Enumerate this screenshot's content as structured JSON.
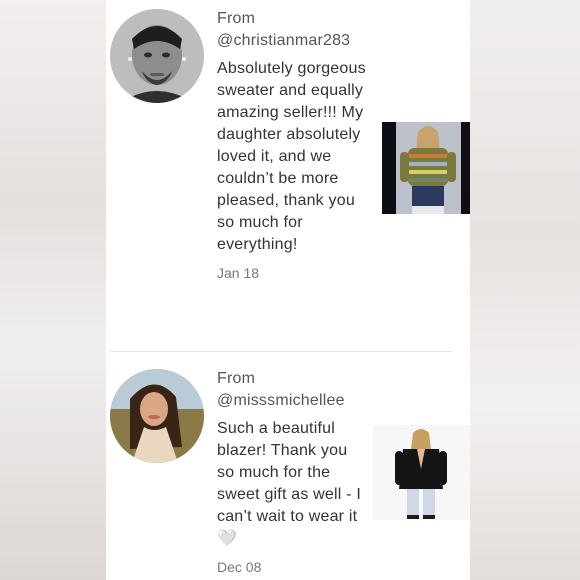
{
  "reviews": [
    {
      "from_label": "From",
      "handle": "@christianmar283",
      "message": "Absolutely gorgeous sweater and equally amazing seller!!! My daughter absolutely loved it, and we couldn’t be more pleased, thank you so much for everything!",
      "date": "Jan 18"
    },
    {
      "from_label": "From",
      "handle": "@misssmichellee",
      "message": "Such a beautiful blazer! Thank you so much for the sweet gift as well - I can’t wait to wear it 🤍",
      "date": "Dec 08"
    }
  ]
}
